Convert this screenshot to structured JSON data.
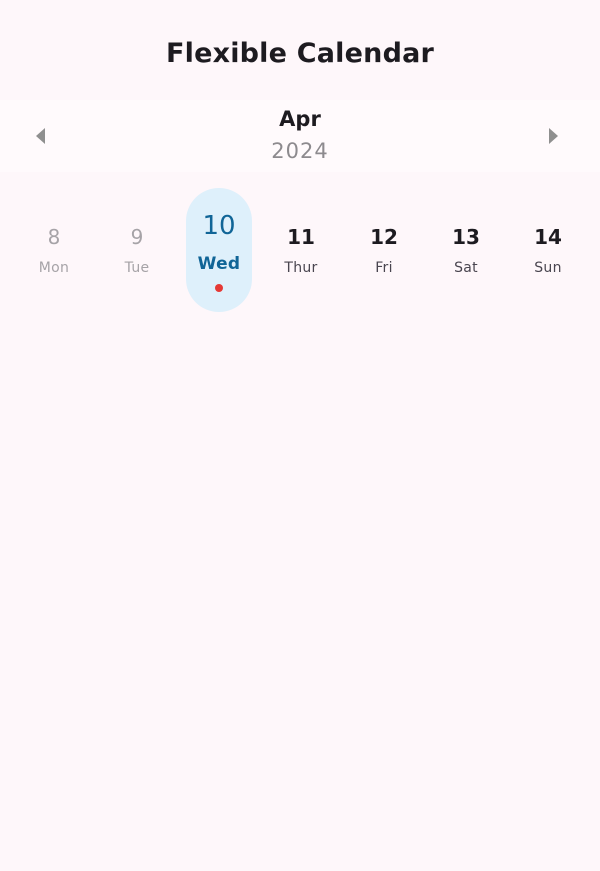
{
  "app_bar": {
    "title": "Flexible Calendar"
  },
  "month_header": {
    "month": "Apr",
    "year": "2024",
    "prev_icon": "arrow-left-icon",
    "next_icon": "arrow-right-icon"
  },
  "week": [
    {
      "day": "8",
      "name": "Mon",
      "state": "past"
    },
    {
      "day": "9",
      "name": "Tue",
      "state": "past"
    },
    {
      "day": "10",
      "name": "Wed",
      "state": "selected",
      "has_event": true
    },
    {
      "day": "11",
      "name": "Thur",
      "state": "upcoming"
    },
    {
      "day": "12",
      "name": "Fri",
      "state": "upcoming"
    },
    {
      "day": "13",
      "name": "Sat",
      "state": "upcoming"
    },
    {
      "day": "14",
      "name": "Sun",
      "state": "upcoming"
    }
  ],
  "colors": {
    "background": "#fef7fa",
    "selected_background": "#def0fb",
    "selected_text": "#106597",
    "past_text": "#a6a3a7",
    "event_dot": "#e53935"
  }
}
